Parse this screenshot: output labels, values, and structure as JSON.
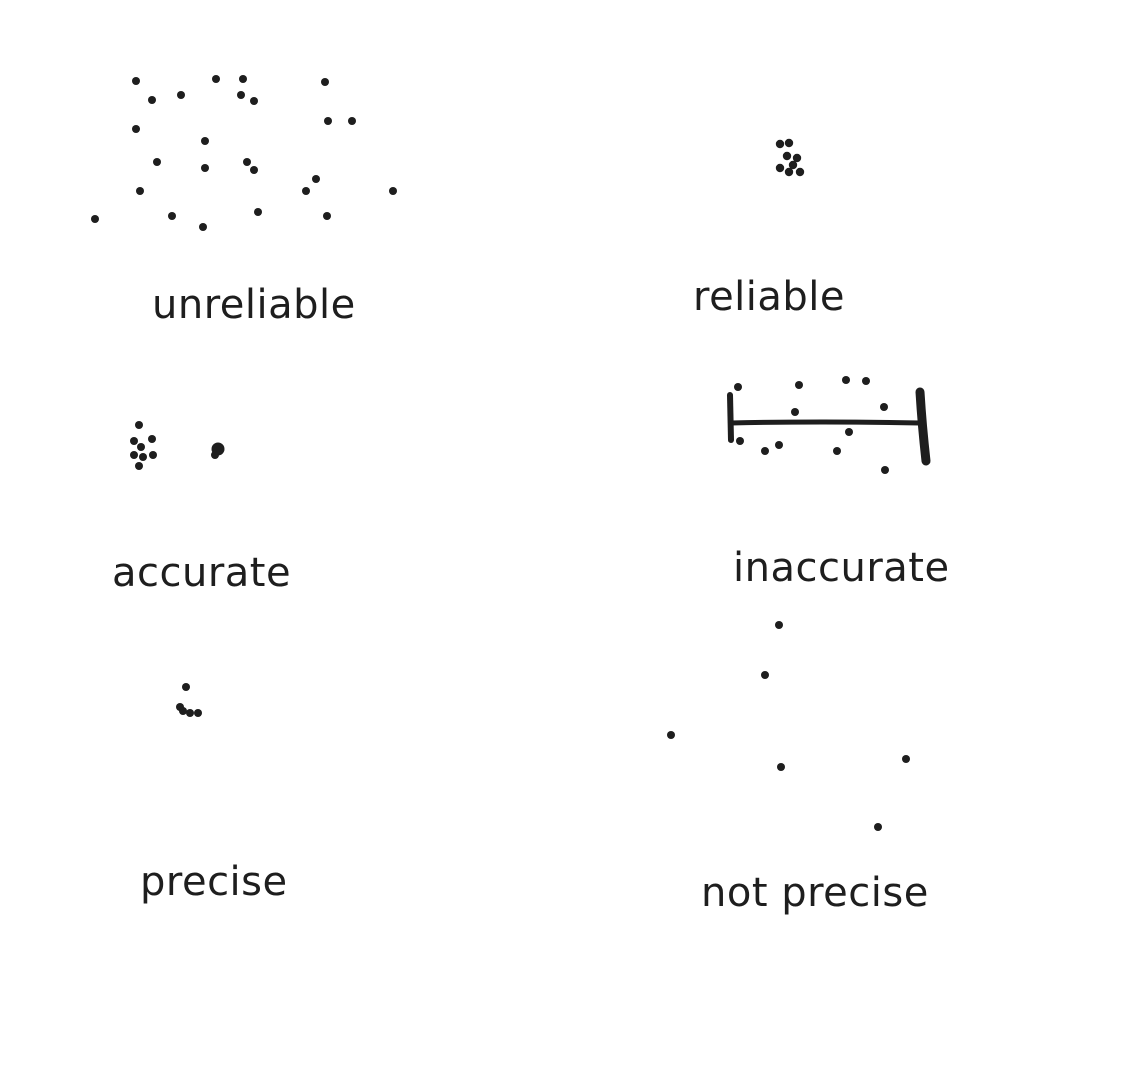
{
  "colors": {
    "ink": "#1e1e1e",
    "background": "#ffffff"
  },
  "labels": {
    "unreliable": "unreliable",
    "reliable": "reliable",
    "accurate": "accurate",
    "inaccurate": "inaccurate",
    "precise": "precise",
    "not_precise": "not precise"
  }
}
